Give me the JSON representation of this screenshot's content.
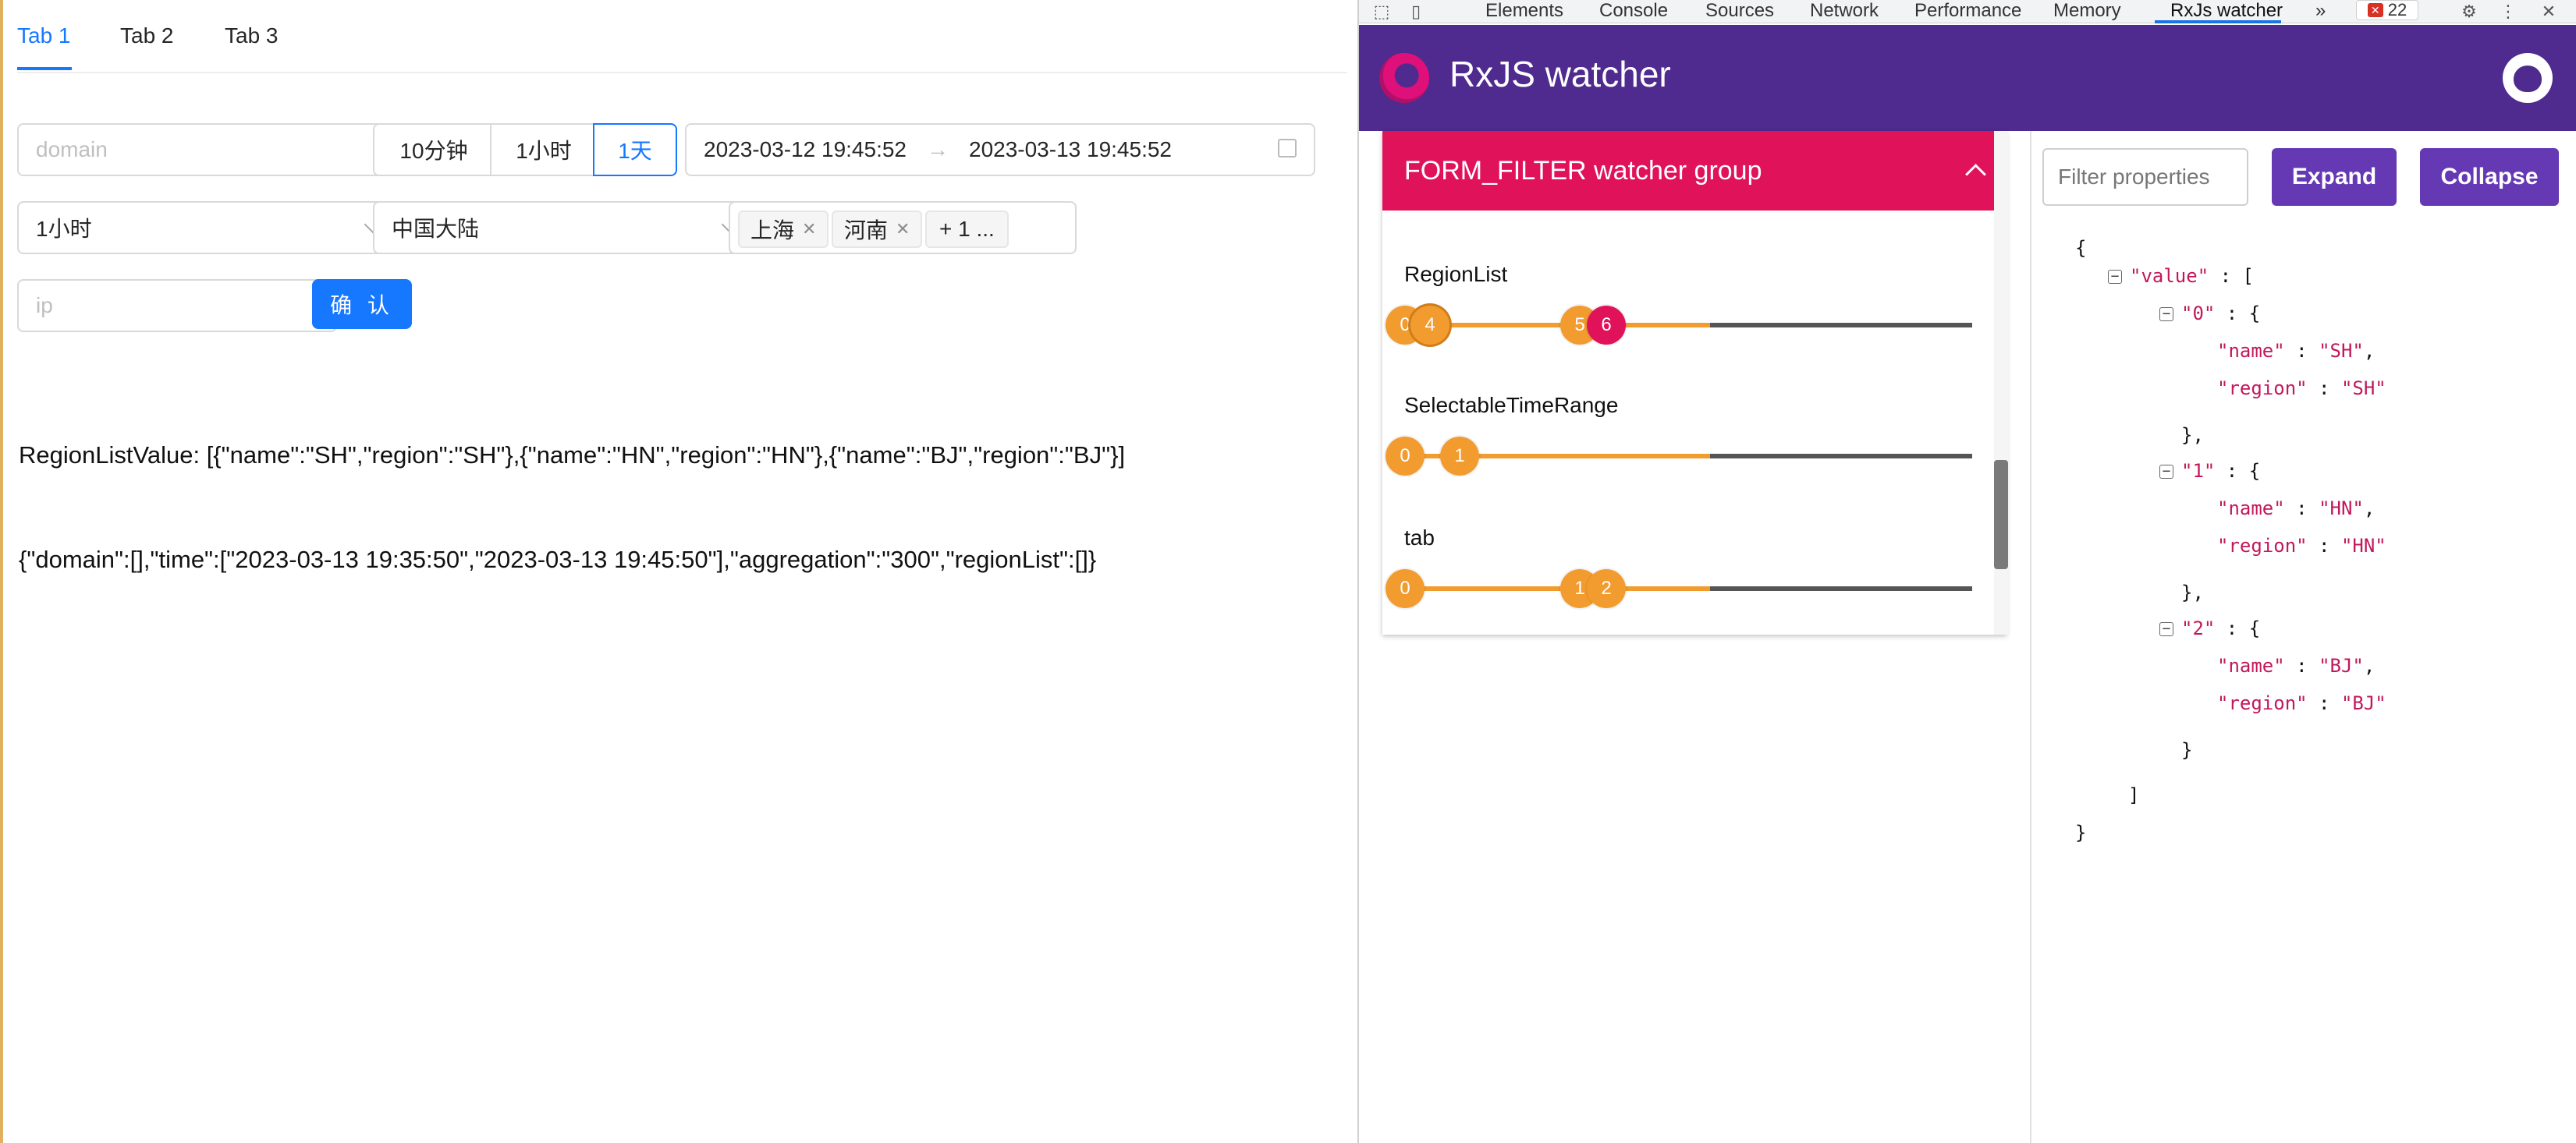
{
  "app": {
    "tabs": [
      {
        "label": "Tab 1",
        "active": true
      },
      {
        "label": "Tab 2",
        "active": false
      },
      {
        "label": "Tab 3",
        "active": false
      }
    ],
    "domain_input": {
      "placeholder": "domain",
      "value": ""
    },
    "time_segments": [
      {
        "label": "10分钟",
        "active": false
      },
      {
        "label": "1小时",
        "active": false
      },
      {
        "label": "1天",
        "active": true
      }
    ],
    "date_range": {
      "start": "2023-03-12 19:45:52",
      "end": "2023-03-13 19:45:52",
      "separator": "→"
    },
    "aggregation_select": {
      "value": "1小时"
    },
    "country_select": {
      "value": "中国大陆"
    },
    "region_tags": [
      {
        "label": "上海"
      },
      {
        "label": "河南"
      }
    ],
    "region_more": "+ 1 ...",
    "ip_input": {
      "placeholder": "ip",
      "value": ""
    },
    "confirm_label": "确 认",
    "region_list_value": "RegionListValue: [{\"name\":\"SH\",\"region\":\"SH\"},{\"name\":\"HN\",\"region\":\"HN\"},{\"name\":\"BJ\",\"region\":\"BJ\"}]",
    "form_state": "{\"domain\":[],\"time\":[\"2023-03-13 19:35:50\",\"2023-03-13 19:45:50\"],\"aggregation\":\"300\",\"regionList\":[]}"
  },
  "devtools": {
    "tabs": [
      "Elements",
      "Console",
      "Sources",
      "Network",
      "Performance",
      "Memory",
      "RxJs watcher"
    ],
    "active_tab": "RxJs watcher",
    "more_tabs": "»",
    "error_count": "22",
    "error_icon": "✕"
  },
  "rx_watcher": {
    "title": "RxJS watcher",
    "group_title": "FORM_FILTER watcher group",
    "colors": {
      "header": "#4f2a8f",
      "group_header": "#e0125a",
      "marble": "#f29b2f",
      "marble_active": "#e0125a",
      "track_past": "#f29b2f",
      "track_future": "#555555",
      "button": "#6539b4"
    },
    "watchers": [
      {
        "name": "RegionList",
        "marbles": [
          "0",
          "4",
          "5",
          "6"
        ],
        "highlight": "6"
      },
      {
        "name": "SelectableTimeRange",
        "marbles": [
          "0",
          "1"
        ]
      },
      {
        "name": "tab",
        "marbles": [
          "0",
          "1",
          "2"
        ]
      }
    ],
    "filter_placeholder": "Filter properties",
    "expand_label": "Expand",
    "collapse_label": "Collapse",
    "json": {
      "open_brace": "{",
      "value_key": "\"value\"",
      "colon": ":",
      "open_bracket": "[",
      "items": [
        {
          "index": "\"0\"",
          "name": "\"SH\"",
          "region": "\"SH\""
        },
        {
          "index": "\"1\"",
          "name": "\"HN\"",
          "region": "\"HN\""
        },
        {
          "index": "\"2\"",
          "name": "\"BJ\"",
          "region": "\"BJ\""
        }
      ],
      "name_key": "\"name\"",
      "region_key": "\"region\"",
      "close_bracket": "]",
      "close_brace": "}"
    }
  }
}
